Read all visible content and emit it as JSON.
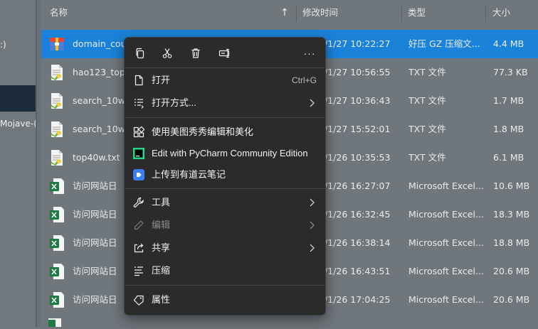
{
  "nav": {
    "items": [
      {
        "label": ":)"
      },
      {
        "label": "Mojave-("
      }
    ]
  },
  "columns": {
    "name": "名称",
    "modified": "修改时间",
    "type": "类型",
    "size": "大小",
    "sort_indicator": "↑"
  },
  "files": [
    {
      "name": "domain_cou",
      "modified": "/1/27 10:22:27",
      "type": "好压 GZ 压缩文...",
      "size": "4.4 MB",
      "icon": "archive-icon",
      "selected": true
    },
    {
      "name": "hao123_top",
      "modified": "/1/27 10:56:55",
      "type": "TXT 文件",
      "size": "77.3 KB",
      "icon": "text-file-icon",
      "selected": false
    },
    {
      "name": "search_10w",
      "modified": "/1/27 10:36:43",
      "type": "TXT 文件",
      "size": "1.7 MB",
      "icon": "text-file-icon",
      "selected": false
    },
    {
      "name": "search_10w",
      "modified": "/1/27 15:52:01",
      "type": "TXT 文件",
      "size": "1.8 MB",
      "icon": "text-file-icon",
      "selected": false
    },
    {
      "name": "top40w.txt",
      "modified": "/1/26 10:35:53",
      "type": "TXT 文件",
      "size": "6.1 MB",
      "icon": "text-file-icon",
      "selected": false
    },
    {
      "name": "访问网站日",
      "modified": "/1/26 16:27:07",
      "type": "Microsoft Excel...",
      "size": "10.6 MB",
      "icon": "excel-file-icon",
      "selected": false
    },
    {
      "name": "访问网站日",
      "modified": "/1/26 16:32:45",
      "type": "Microsoft Excel...",
      "size": "18.3 MB",
      "icon": "excel-file-icon",
      "selected": false
    },
    {
      "name": "访问网站日",
      "modified": "/1/26 16:38:14",
      "type": "Microsoft Excel...",
      "size": "18.8 MB",
      "icon": "excel-file-icon",
      "selected": false
    },
    {
      "name": "访问网站日",
      "modified": "/1/26 16:43:51",
      "type": "Microsoft Excel...",
      "size": "20.6 MB",
      "icon": "excel-file-icon",
      "selected": false
    },
    {
      "name": "访问网站日",
      "modified": "/1/26 17:04:25",
      "type": "Microsoft Excel...",
      "size": "20.6 MB",
      "icon": "excel-file-icon",
      "selected": false
    }
  ],
  "context_menu": {
    "quick_actions": [
      {
        "icon": "copy-icon"
      },
      {
        "icon": "cut-icon"
      },
      {
        "icon": "delete-icon"
      },
      {
        "icon": "rename-icon"
      },
      {
        "icon": "more-icon",
        "label": "···"
      }
    ],
    "items": [
      {
        "label": "打开",
        "accelerator": "Ctrl+G",
        "icon": "open-file-icon"
      },
      {
        "label": "打开方式...",
        "icon": "open-with-icon",
        "submenu": true
      },
      {
        "label": "使用美图秀秀编辑和美化",
        "icon": "meitu-icon"
      },
      {
        "label": "Edit with PyCharm Community Edition",
        "icon": "pycharm-icon",
        "icon_text": "PC"
      },
      {
        "label": "上传到有道云笔记",
        "icon": "youdao-note-icon"
      },
      {
        "label": "工具",
        "icon": "wrench-icon",
        "submenu": true
      },
      {
        "label": "编辑",
        "icon": "pencil-icon",
        "submenu": true,
        "disabled": true
      },
      {
        "label": "共享",
        "icon": "share-icon",
        "submenu": true
      },
      {
        "label": "压缩",
        "icon": "compress-icon"
      },
      {
        "label": "属性",
        "icon": "properties-icon"
      }
    ]
  },
  "colors": {
    "selection": "#1a82d9",
    "menu_bg": "#2b2b2b",
    "excel_green": "#1d7a43",
    "youdao_blue": "#3c7ff2"
  }
}
